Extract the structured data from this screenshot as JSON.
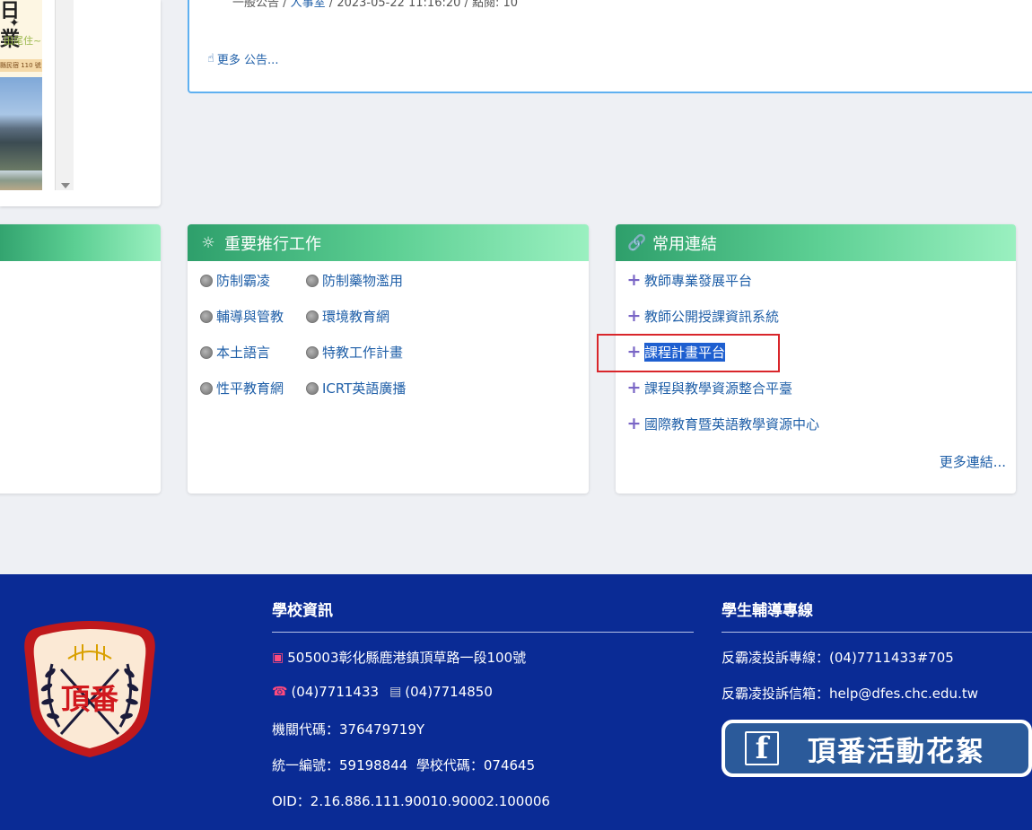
{
  "poster": {
    "title": "日 業",
    "star": "✦",
    "subtitle": "田尾住~",
    "band": "縣民宿 110 號"
  },
  "announcements": {
    "meta_prefix": "一般公告 / ",
    "meta_dept": "人事室",
    "meta_suffix": " / 2023-05-22 11:16:20 / 點閱: 10",
    "more_label": "更多 公告..."
  },
  "work_panel": {
    "title": "重要推行工作",
    "icon": "sun-icon",
    "items": [
      "防制霸凌",
      "防制藥物濫用",
      "輔導與管教",
      "環境教育網",
      "本土語言",
      "特教工作計畫",
      "性平教育網",
      "ICRT英語廣播"
    ]
  },
  "links_panel": {
    "title": "常用連結",
    "icon": "link-icon",
    "items": [
      "教師專業發展平台",
      "教師公開授課資訊系統",
      "課程計畫平台",
      "課程與教學資源整合平臺",
      "國際教育暨英語教學資源中心"
    ],
    "selected_index": 2,
    "more_label": "更多連結..."
  },
  "footer": {
    "school_info": {
      "title": "學校資訊",
      "address": "505003彰化縣鹿港鎮頂草路一段100號",
      "phone": "(04)7711433",
      "fax": "(04)7714850",
      "agency_code": "機關代碼：376479719Y",
      "ids": "統一編號：59198844  學校代碼：074645",
      "oid": "OID：2.16.886.111.90010.90002.100006"
    },
    "counsel": {
      "title": "學生輔導專線",
      "hotline": "反霸凌投訴專線：(04)7711433#705",
      "email": "反霸凌投訴信箱：help@dfes.chc.edu.tw"
    },
    "fb_banner": {
      "letter": "f",
      "label": "頂番活動花絮"
    },
    "logo_text": "頂番"
  },
  "colors": {
    "footer_bg": "#0a2b95",
    "panel_header": "#2e9f6b",
    "link": "#1f5fa8",
    "highlight": "#d9262b",
    "selection": "#1e5fd0"
  }
}
